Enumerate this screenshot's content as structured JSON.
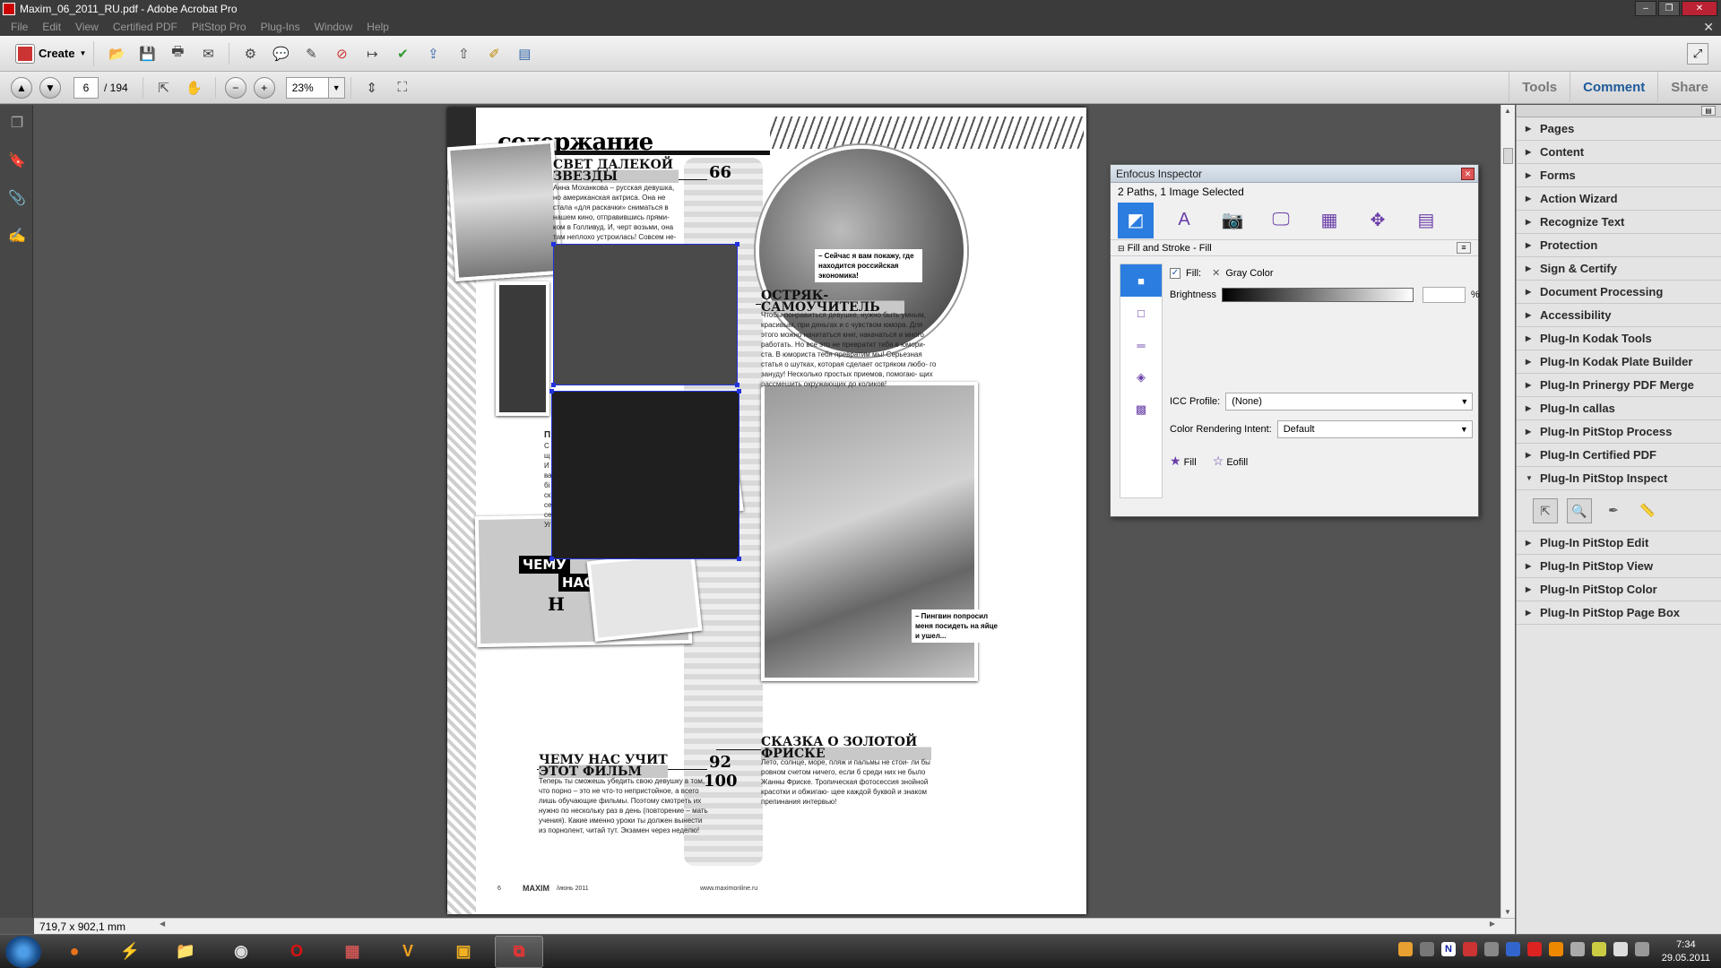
{
  "window": {
    "title": "Maxim_06_2011_RU.pdf - Adobe Acrobat Pro"
  },
  "menu": [
    "File",
    "Edit",
    "View",
    "Certified PDF",
    "PitStop Pro",
    "Plug-Ins",
    "Window",
    "Help"
  ],
  "toolbar": {
    "create_label": "Create"
  },
  "nav": {
    "page_current": "6",
    "page_total": "/ 194",
    "zoom": "23%"
  },
  "tabs": {
    "tools": "Tools",
    "comment": "Comment",
    "share": "Share"
  },
  "status": {
    "dimensions": "719,7 x 902,1 mm"
  },
  "document": {
    "heading": "содержание",
    "articles": [
      {
        "title": "СВЕТ ДАЛЕКОЙ ЗВЕЗДЫ",
        "body": "Анна Моханкова – русская девушка, но американская актриса. Она не стала «для раскачки» сниматься в нашем кино, отправившись прями- ком в Голливуд. И, черт возьми, она там неплохо устроилась! Совсем не- давно мы видели ее в фильме «Же-"
      },
      {
        "title": "ОСТРЯК- САМОУЧИТЕЛЬ",
        "body": "Чтобы понравиться девушке, нужно быть умным, красивым, при деньгах и с чувством юмора. Для этого можно начитаться книг, накачаться и много работать. Но все это не превратит тебя в юмори- ста. В юмориста тебя превратим мы! Серьезная статья о шутках, которая сделает остряком любо- го зануду! Несколько простых приемов, помогаю- щих рассмешить окружающих до коликов!"
      },
      {
        "title": "СКАЗКА О ЗОЛОТОЙ ФРИСКЕ",
        "body": "Лето, солнце, море, пляж и пальмы не стои- ли бы ровном счетом ничего, если б среди них не было Жанны Фриске. Тропическая фотосессия знойной красотки и обжигаю- щее каждой буквой и знаком препинания интервью!"
      },
      {
        "title": "ЧЕМУ НАС УЧИТ ЭТОТ ФИЛЬМ",
        "body": "Теперь ты сможешь убедить свою девушку в том, что порно – это не что-то непристойное, а всего лишь обучающие фильмы. Поэтому смотреть их нужно по нескольку раз в день (повторение – мать учения). Какие именно уроки ты должен вынести из порнолент, читай тут. Экзамен через неделю!"
      }
    ],
    "page_numbers": [
      "66",
      "92",
      "100"
    ],
    "captions": [
      "– Сейчас я вам покажу, где находится российская экономика!",
      "– Пингвин попросил меня посидеть на яйце и ушел..."
    ],
    "collage_text": [
      "ЧЕМУ",
      "НАС",
      "Н"
    ],
    "partial_letters": [
      "П",
      "С щ И ва бі ск се се Уг"
    ],
    "footer": {
      "page": "6",
      "brand": "MAXIM",
      "date": "/июнь 2011",
      "url": "www.maximonline.ru"
    }
  },
  "inspector": {
    "title": "Enfocus Inspector",
    "selection": "2 Paths, 1 Image Selected",
    "section": "Fill and Stroke - Fill",
    "fill_label": "Fill:",
    "fill_color": "Gray Color",
    "brightness_label": "Brightness",
    "percent": "%",
    "icc_label": "ICC Profile:",
    "icc_value": "(None)",
    "intent_label": "Color Rendering Intent:",
    "intent_value": "Default",
    "fill_btn": "Fill",
    "eofill_btn": "Eofill"
  },
  "panel": {
    "items_top": [
      "Pages",
      "Content",
      "Forms",
      "Action Wizard",
      "Recognize Text",
      "Protection",
      "Sign & Certify",
      "Document Processing",
      "Accessibility",
      "Plug-In Kodak Tools",
      "Plug-In Kodak Plate Builder",
      "Plug-In Prinergy PDF Merge",
      "Plug-In callas",
      "Plug-In PitStop Process",
      "Plug-In Certified PDF",
      "Plug-In PitStop Inspect"
    ],
    "items_bottom": [
      "Plug-In PitStop Edit",
      "Plug-In PitStop View",
      "Plug-In PitStop Color",
      "Plug-In PitStop Page Box"
    ]
  },
  "taskbar": {
    "time": "7:34",
    "date": "29.05.2011",
    "tray_letter": "N"
  },
  "colors": {
    "accent": "#2b7de0",
    "comment_tab": "#1e5a9a",
    "selection": "#2233dd",
    "icon_purple": "#6a3ea8"
  }
}
